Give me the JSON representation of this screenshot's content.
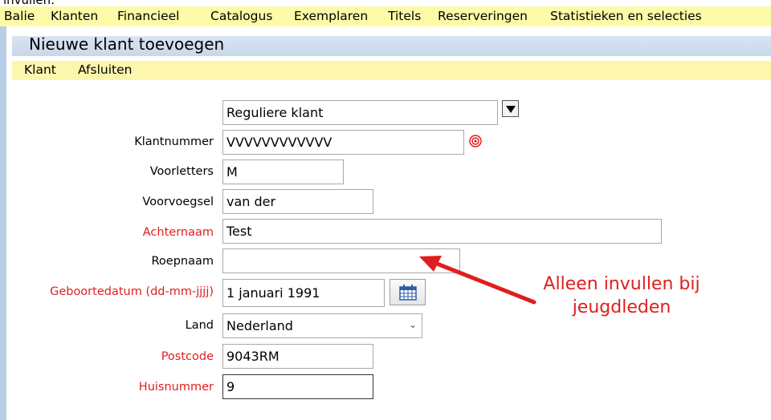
{
  "menu": {
    "items": [
      "Balie",
      "Klanten",
      "Financieel",
      "Catalogus",
      "Exemplaren",
      "Titels",
      "Reserveringen",
      "Statistieken en selecties"
    ]
  },
  "window": {
    "title": "Nieuwe klant toevoegen",
    "toolbar": [
      "Klant",
      "Afsluiten"
    ]
  },
  "form": {
    "customer_type": "Reguliere klant",
    "klantnummer": {
      "label": "Klantnummer",
      "value": "VVVVVVVVVVVV"
    },
    "voorletters": {
      "label": "Voorletters",
      "value": "M"
    },
    "voorvoegsel": {
      "label": "Voorvoegsel",
      "value": "van der"
    },
    "achternaam": {
      "label": "Achternaam",
      "value": "Test"
    },
    "roepnaam": {
      "label": "Roepnaam",
      "value": ""
    },
    "geboortedatum": {
      "label": "Geboortedatum (dd-mm-jjjj)",
      "value": "1 januari 1991"
    },
    "land": {
      "label": "Land",
      "value": "Nederland"
    },
    "postcode": {
      "label": "Postcode",
      "value": "9043RM"
    },
    "huisnummer": {
      "label": "Huisnummer",
      "value": "9"
    }
  },
  "annotation": {
    "line1": "Alleen invullen bij",
    "line2": "jeugdleden"
  },
  "colors": {
    "menubar": "#fdfaa8",
    "titlebar": "#d3deef",
    "required_label": "#e01e1e",
    "annotation": "#e01e1e"
  },
  "icons": [
    "target-icon",
    "calendar-icon",
    "chevron-down-icon",
    "arrow-icon"
  ]
}
